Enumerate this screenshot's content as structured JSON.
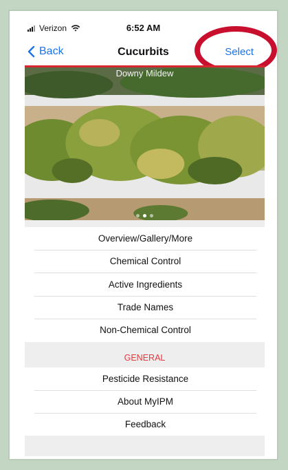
{
  "status_bar": {
    "carrier": "Verizon",
    "time": "6:52 AM"
  },
  "nav": {
    "back_label": "Back",
    "title": "Cucurbits",
    "select_label": "Select"
  },
  "hero": {
    "caption": "Downy Mildew",
    "page_count": 3,
    "active_page": 2
  },
  "menu": {
    "items": [
      {
        "label": "Overview/Gallery/More"
      },
      {
        "label": "Chemical Control"
      },
      {
        "label": "Active Ingredients"
      },
      {
        "label": "Trade Names"
      },
      {
        "label": "Non-Chemical Control"
      }
    ]
  },
  "general": {
    "header": "GENERAL",
    "items": [
      {
        "label": "Pesticide Resistance"
      },
      {
        "label": "About MyIPM"
      },
      {
        "label": "Feedback"
      }
    ]
  },
  "colors": {
    "accent": "#1a73e8",
    "header_red": "#e0393e",
    "annotation_red": "#c8102e"
  }
}
